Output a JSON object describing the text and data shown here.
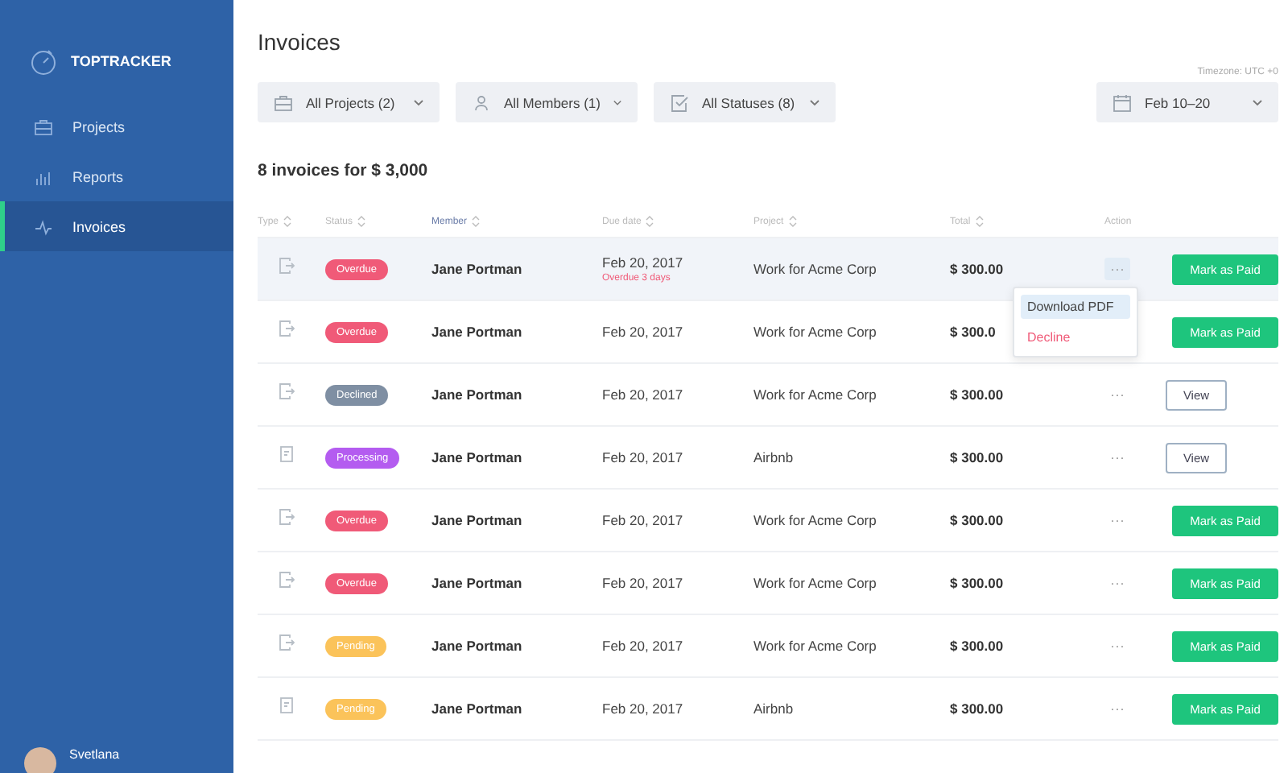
{
  "sidebar": {
    "brand": "TOPTRACKER",
    "items": [
      {
        "label": "Projects",
        "selected": false
      },
      {
        "label": "Reports",
        "selected": false
      },
      {
        "label": "Invoices",
        "selected": true
      }
    ],
    "user": {
      "name": "Svetlana"
    }
  },
  "page": {
    "title": "Invoices",
    "timezone": "Timezone: UTC +0"
  },
  "filters": [
    {
      "label": "All Projects (2)"
    },
    {
      "label": "All Members (1)"
    },
    {
      "label": "All Statuses (8)"
    }
  ],
  "date_filter": {
    "label": "Feb 10–20"
  },
  "summary": "8 invoices for $ 3,000",
  "table": {
    "columns": [
      {
        "label": "Type",
        "selected": false
      },
      {
        "label": "Status",
        "selected": false
      },
      {
        "label": "Member",
        "selected": true
      },
      {
        "label": "Due date",
        "selected": false
      },
      {
        "label": "Project",
        "selected": false
      },
      {
        "label": "Total",
        "selected": false
      },
      {
        "label": "Action",
        "selected": false
      }
    ],
    "rows": [
      {
        "kind": "export",
        "status": "Overdue",
        "color": "#f05a78",
        "member": "Jane Portman",
        "due": "Feb 20, 2017",
        "note": "Overdue 3 days",
        "project": "Work for Acme Corp",
        "total": "$ 300.00",
        "more": "···",
        "action": {
          "kind": "mark",
          "label": "Mark as Paid"
        },
        "selected": true,
        "menu": {
          "items": [
            {
              "label": "Download PDF",
              "kind": "normal",
              "selected": true
            },
            {
              "label": "Decline",
              "kind": "danger",
              "selected": false
            }
          ]
        }
      },
      {
        "kind": "export",
        "status": "Overdue",
        "color": "#f05a78",
        "member": "Jane Portman",
        "due": "Feb 20, 2017",
        "project": "Work for Acme Corp",
        "total": "$ 300.0",
        "action": {
          "kind": "mark",
          "label": "Mark as Paid"
        },
        "selected": false
      },
      {
        "kind": "export",
        "status": "Declined",
        "color": "#7f8fa3",
        "member": "Jane Portman",
        "due": "Feb 20, 2017",
        "project": "Work for Acme Corp",
        "total": "$ 300.00",
        "more": "···",
        "action": {
          "kind": "view",
          "label": "View"
        },
        "selected": false
      },
      {
        "kind": "plain",
        "status": "Processing",
        "color": "#b45cf0",
        "member": "Jane Portman",
        "due": "Feb 20, 2017",
        "project": "Airbnb",
        "total": "$ 300.00",
        "more": "···",
        "action": {
          "kind": "view",
          "label": "View"
        },
        "selected": false
      },
      {
        "kind": "export",
        "status": "Overdue",
        "color": "#f05a78",
        "member": "Jane Portman",
        "due": "Feb 20, 2017",
        "project": "Work for Acme Corp",
        "total": "$ 300.00",
        "more": "···",
        "action": {
          "kind": "mark",
          "label": "Mark as Paid"
        },
        "selected": false
      },
      {
        "kind": "export",
        "status": "Overdue",
        "color": "#f05a78",
        "member": "Jane Portman",
        "due": "Feb 20, 2017",
        "project": "Work for Acme Corp",
        "total": "$ 300.00",
        "more": "···",
        "action": {
          "kind": "mark",
          "label": "Mark as Paid"
        },
        "selected": false
      },
      {
        "kind": "export",
        "status": "Pending",
        "color": "#fbc35a",
        "member": "Jane Portman",
        "due": "Feb 20, 2017",
        "project": "Work for Acme Corp",
        "total": "$ 300.00",
        "more": "···",
        "action": {
          "kind": "mark",
          "label": "Mark as Paid"
        },
        "selected": false
      },
      {
        "kind": "plain",
        "status": "Pending",
        "color": "#fbc35a",
        "member": "Jane Portman",
        "due": "Feb 20, 2017",
        "project": "Airbnb",
        "total": "$ 300.00",
        "more": "···",
        "action": {
          "kind": "mark",
          "label": "Mark as Paid"
        },
        "selected": false
      }
    ]
  }
}
